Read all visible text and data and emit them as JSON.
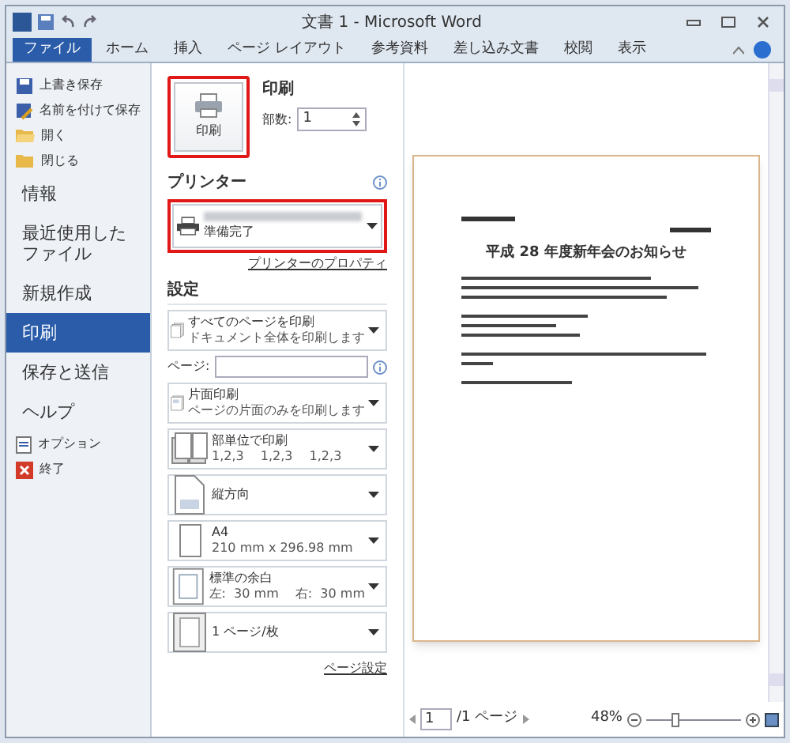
{
  "window": {
    "title": "文書 1 - Microsoft Word"
  },
  "tabs": [
    {
      "label": "ファイル",
      "selected": true
    },
    {
      "label": "ホーム",
      "selected": false
    },
    {
      "label": "挿入",
      "selected": false
    },
    {
      "label": "ページ レイアウト",
      "selected": false
    },
    {
      "label": "参考資料",
      "selected": false
    },
    {
      "label": "差し込み文書",
      "selected": false
    },
    {
      "label": "校閲",
      "selected": false
    },
    {
      "label": "表示",
      "selected": false
    }
  ],
  "sidebar": {
    "items": [
      {
        "kind": "command",
        "label": "上書き保存",
        "selected": false
      },
      {
        "kind": "command",
        "label": "名前を付けて保存",
        "selected": false
      },
      {
        "kind": "command",
        "label": "開く",
        "selected": false
      },
      {
        "kind": "command",
        "label": "閉じる",
        "selected": false
      },
      {
        "kind": "section",
        "label": "情報",
        "selected": false
      },
      {
        "kind": "section",
        "label": "最近使用したファイル",
        "selected": false
      },
      {
        "kind": "section",
        "label": "新規作成",
        "selected": false
      },
      {
        "kind": "section",
        "label": "印刷",
        "selected": true
      },
      {
        "kind": "section",
        "label": "保存と送信",
        "selected": false
      },
      {
        "kind": "section",
        "label": "ヘルプ",
        "selected": false
      },
      {
        "kind": "command",
        "label": "オプション",
        "selected": false
      },
      {
        "kind": "command",
        "label": "終了",
        "selected": false
      }
    ]
  },
  "print": {
    "button": "印刷",
    "heading": "印刷",
    "copies_label": "部数:",
    "copies": "1"
  },
  "printer": {
    "heading": "プリンター",
    "status": "準備完了",
    "properties_link": "プリンターのプロパティ"
  },
  "settings": {
    "heading": "設定",
    "pages_label": "ページ:",
    "page_setup_link": "ページ設定",
    "options": [
      {
        "title": "すべてのページを印刷",
        "subtitle": "ドキュメント全体を印刷します"
      },
      {
        "title": "片面印刷",
        "subtitle": "ページの片面のみを印刷します"
      },
      {
        "title": "部単位で印刷",
        "subtitle": "1,2,3　 1,2,3　 1,2,3"
      },
      {
        "title": "縦方向"
      },
      {
        "title": "A4",
        "subtitle": "210 mm x 296.98 mm"
      },
      {
        "title": "標準の余白",
        "subtitle": "左:  30 mm　 右:  30 mm"
      },
      {
        "title": "1 ページ/枚"
      }
    ]
  },
  "preview": {
    "document_title": "平成 28 年度新年会のお知らせ",
    "page": "1",
    "page_total": "/1 ページ",
    "zoom": "48%",
    "zoom_slider": {
      "level": 0.3
    }
  }
}
